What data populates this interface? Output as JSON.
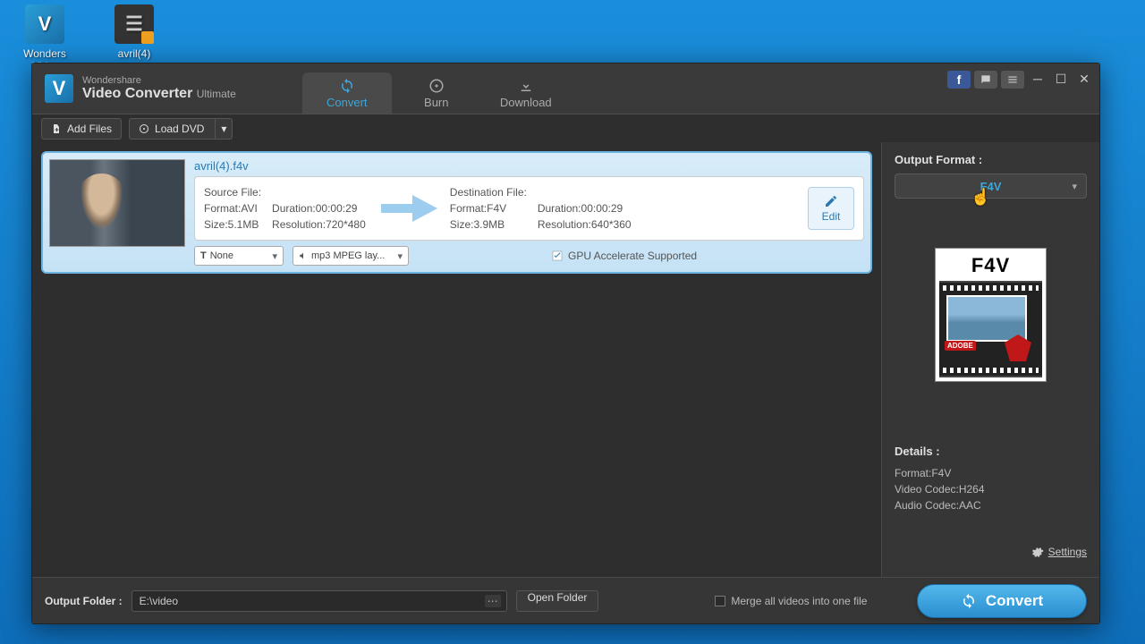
{
  "desktop": {
    "icons": [
      {
        "label": "Wonders\nVid...",
        "glyph": "V"
      },
      {
        "label": "avril(4)",
        "glyph": "▶"
      }
    ]
  },
  "app": {
    "brand": "Wondershare",
    "name": "Video Converter",
    "edition": "Ultimate"
  },
  "tabs": [
    {
      "id": "convert",
      "label": "Convert",
      "active": true
    },
    {
      "id": "burn",
      "label": "Burn",
      "active": false
    },
    {
      "id": "download",
      "label": "Download",
      "active": false
    }
  ],
  "toolbar": {
    "add_files": "Add Files",
    "load_dvd": "Load DVD"
  },
  "file": {
    "name": "avril(4).f4v",
    "source": {
      "title": "Source File:",
      "format": "Format:AVI",
      "size": "Size:5.1MB",
      "duration": "Duration:00:00:29",
      "resolution": "Resolution:720*480"
    },
    "dest": {
      "title": "Destination File:",
      "format": "Format:F4V",
      "size": "Size:3.9MB",
      "duration": "Duration:00:00:29",
      "resolution": "Resolution:640*360"
    },
    "edit_label": "Edit",
    "subtitle_select": "None",
    "audio_select": "mp3 MPEG lay...",
    "gpu_label": "GPU Accelerate Supported"
  },
  "output": {
    "label": "Output Format :",
    "selected": "F4V",
    "preview_label": "F4V",
    "preview_badge": "ADOBE",
    "details_label": "Details :",
    "details": {
      "format": "Format:F4V",
      "vcodec": "Video Codec:H264",
      "acodec": "Audio Codec:AAC"
    },
    "settings": "Settings"
  },
  "footer": {
    "output_folder_label": "Output Folder :",
    "output_folder_value": "E:\\video",
    "open_folder": "Open Folder",
    "merge_label": "Merge all videos into one file",
    "convert": "Convert"
  }
}
